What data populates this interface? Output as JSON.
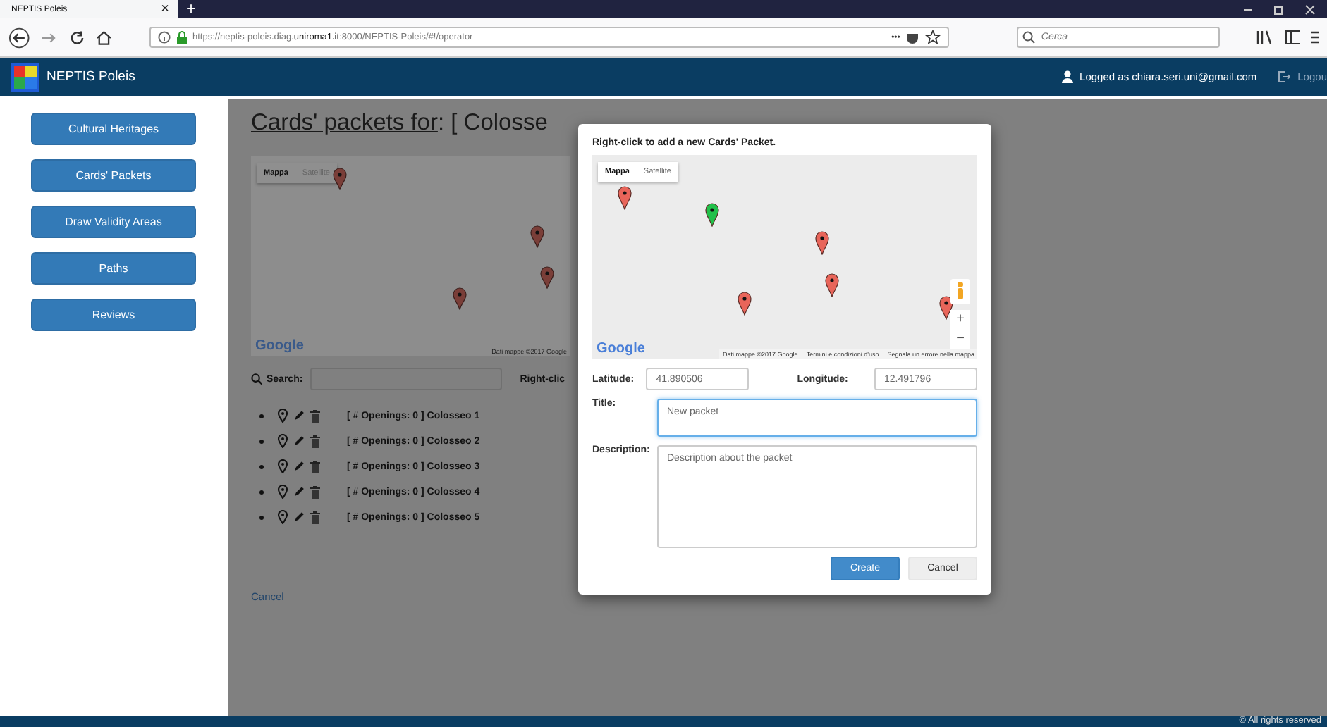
{
  "browser": {
    "tab_title": "NEPTIS Poleis",
    "close_tab": "×",
    "new_tab": "+",
    "url": "https://neptis-poleis.diag.**uniroma1.it**:8000/NEPTIS-Poleis/#!/operator",
    "more": "•••",
    "search_placeholder": "Cerca"
  },
  "navbar": {
    "brand": "NEPTIS Poleis",
    "user": "Logged as chiara.seri.uni@gmail.com",
    "logout": "Logou"
  },
  "sidebar": {
    "buttons": [
      "Cultural Heritages",
      "Cards' Packets",
      "Draw Validity Areas",
      "Paths",
      "Reviews"
    ]
  },
  "page": {
    "title_link": "Cards' packets for",
    "title_rest": ": [ Colosse",
    "map": {
      "map_types": [
        {
          "label": "Mappa",
          "selected": true
        },
        {
          "label": "Satellite",
          "selected": false
        }
      ],
      "logo": "Google",
      "attribution": "Dati mappe ©2017 Google"
    },
    "search_label": "Search:",
    "hint": "Right-clic",
    "packets": [
      "[ # Openings: 0 ] Colosseo 1",
      "[ # Openings: 0 ] Colosseo 2",
      "[ # Openings: 0 ] Colosseo 3",
      "[ # Openings: 0 ] Colosseo 4",
      "[ # Openings: 0 ] Colosseo 5"
    ],
    "cancel": "Cancel"
  },
  "dialog": {
    "instruction": "Right-click to add a new Cards' Packet.",
    "map": {
      "map_types": [
        {
          "label": "Mappa",
          "selected": true
        },
        {
          "label": "Satellite",
          "selected": false
        }
      ],
      "pins": [
        {
          "color": "#e8655a"
        },
        {
          "color": "#22c04a"
        },
        {
          "color": "#e8655a"
        },
        {
          "color": "#e8655a"
        },
        {
          "color": "#e8655a"
        },
        {
          "color": "#e8655a"
        }
      ],
      "logo": "Google",
      "attribution": "Dati mappe ©2017 Google",
      "terms": "Termini e condizioni d'uso",
      "report": "Segnala un errore nella mappa",
      "zoom_in": "+",
      "zoom_out": "−"
    },
    "latitude_label": "Latitude:",
    "latitude": "41.890506",
    "longitude_label": "Longitude:",
    "longitude": "12.491796",
    "title_label": "Title:",
    "title_placeholder": "New packet",
    "title_focused": true,
    "description_label": "Description:",
    "description_placeholder": "Description about the packet",
    "buttons": [
      {
        "label": "Create",
        "kind": "primary"
      },
      {
        "label": "Cancel",
        "kind": "default"
      }
    ]
  },
  "footer": {
    "text": "© All rights reserved"
  }
}
